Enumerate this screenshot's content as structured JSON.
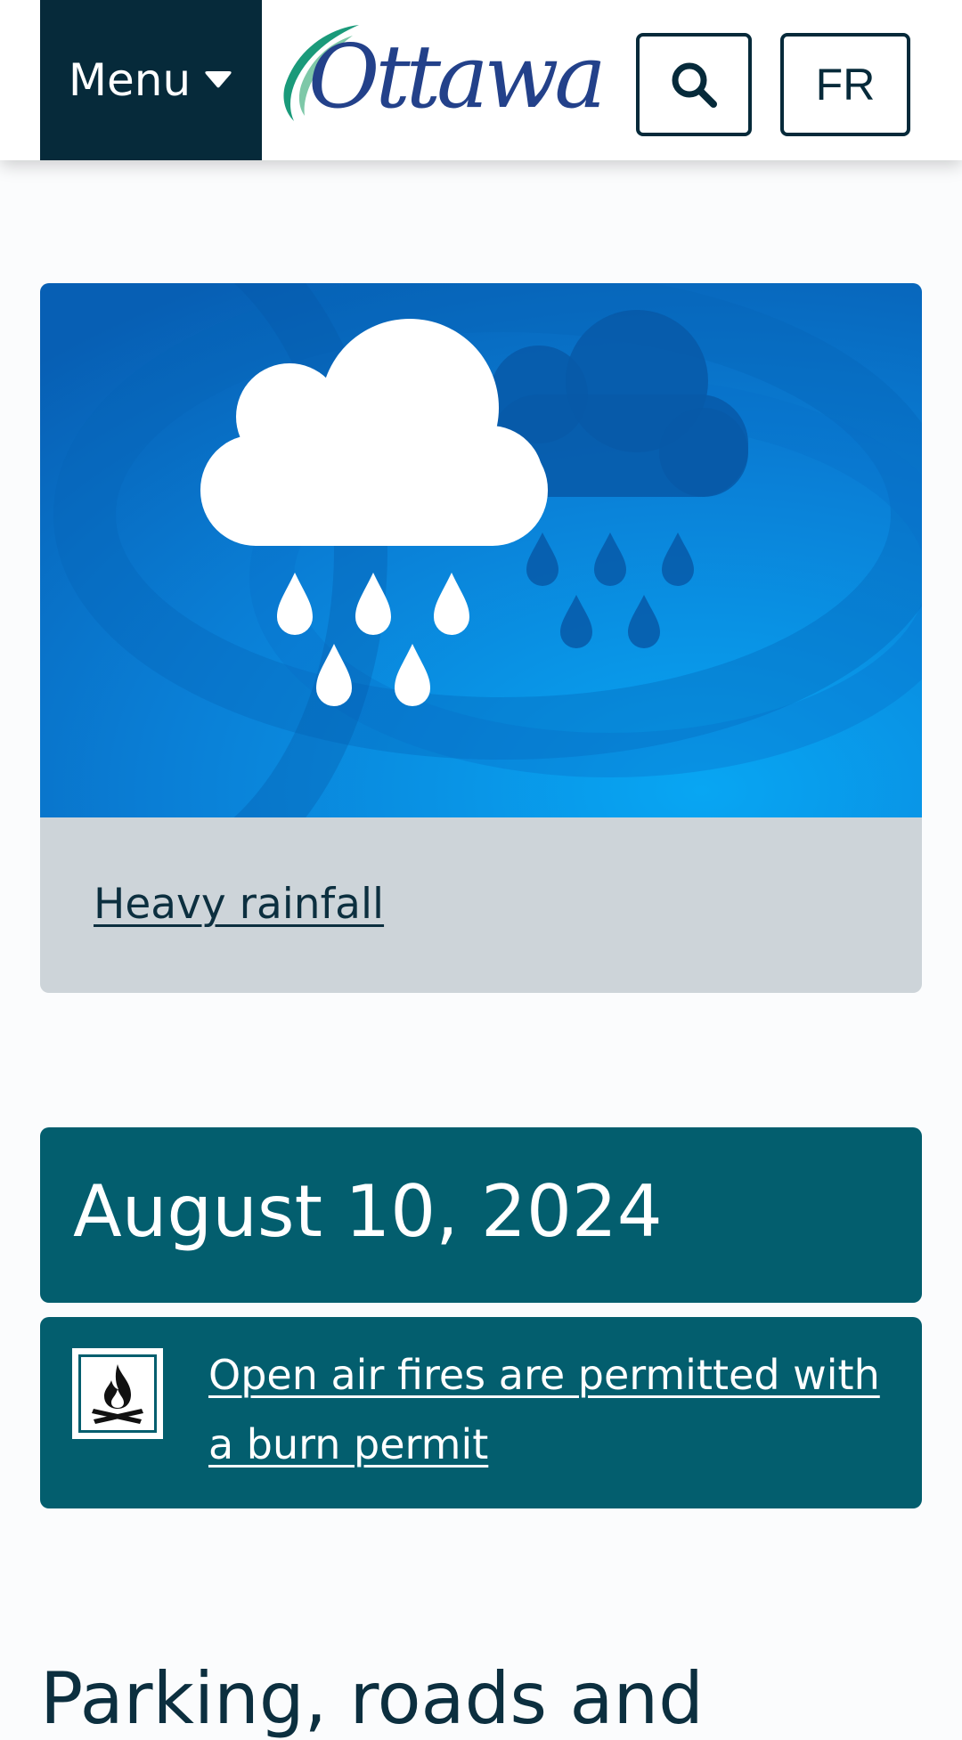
{
  "header": {
    "menu_label": "Menu",
    "logo_text": "Ottawa",
    "language_toggle": "FR",
    "colors": {
      "menu_bg": "#062a3a",
      "logo_blue": "#23418a",
      "logo_green": "#1a9a7a"
    }
  },
  "rain_card": {
    "image_icon": "rain-cloud-icon",
    "link_label": "Heavy rainfall",
    "colors": {
      "image_blue": "#0a78d0",
      "caption_bg": "#cdd4d9"
    }
  },
  "date_banner": {
    "date": "August 10, 2024",
    "color": "#035e6e"
  },
  "fire_notice": {
    "icon": "campfire-icon",
    "link_label": "Open air fires are permitted with a burn permit"
  },
  "next_section": {
    "heading": "Parking, roads and"
  }
}
